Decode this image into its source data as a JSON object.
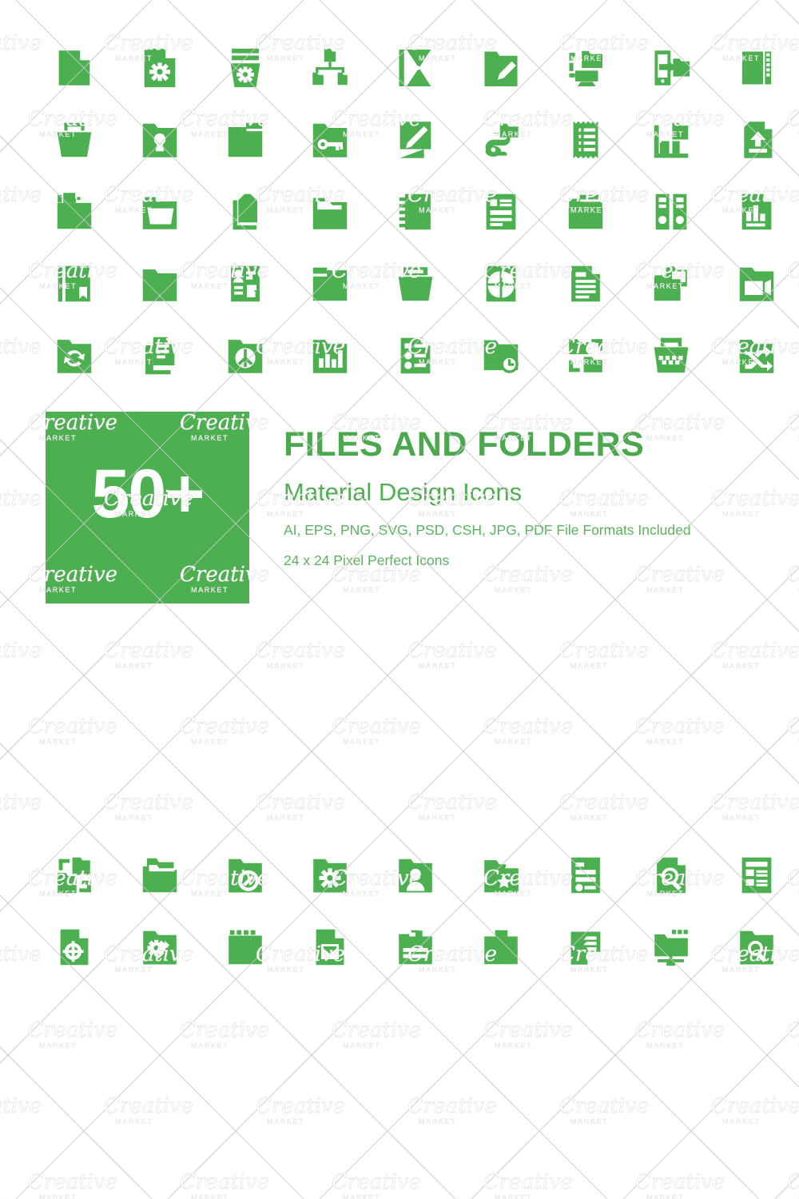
{
  "promo": {
    "badge_count": "50+",
    "badge_color": "#4caf50",
    "title": "FILES AND FOLDERS",
    "subtitle": "Material Design Icons",
    "line1": "AI, EPS, PNG, SVG, PSD, CSH, JPG, PDF File Formats Included",
    "line2": "24 x 24 Pixel Perfect Icons",
    "title_color": "#4aa84d"
  },
  "watermark": {
    "brand": "Creative",
    "sub": "MARKET"
  },
  "icon_color": "#4caf50",
  "grids": {
    "top": {
      "columns": 9,
      "rows": 5,
      "icons": [
        "file-blank-icon",
        "file-settings-icon",
        "folder-settings-icon",
        "folder-hierarchy-icon",
        "file-previous-icon",
        "folder-edit-icon",
        "folder-desktop-icon",
        "folder-mobile-transfer-icon",
        "file-zip-icon",
        "folder-basket-icon",
        "folder-lock-icon",
        "folder-blank-icon",
        "folder-key-icon",
        "file-signature-icon",
        "folder-link-icon",
        "receipt-icon",
        "folder-presentation-icon",
        "file-upload-icon",
        "folder-open-files-icon",
        "folder-open-icon",
        "file-copy-icon",
        "folder-open-empty-icon",
        "notebook-icon",
        "file-list-icon",
        "folder-archive-icon",
        "binders-icon",
        "file-chart-icon",
        "file-bookmark-icon",
        "folder-wide-icon",
        "file-profile-icon",
        "folder-tab-icon",
        "folder-drawer-icon",
        "file-pie-chart-icon",
        "file-text-icon",
        "folder-copy-icon",
        "folder-video-icon",
        "folder-sync-icon",
        "file-duplicate-list-icon",
        "folder-peace-icon",
        "folder-bar-chart-icon",
        "file-checklist-icon",
        "folder-clock-icon",
        "folder-move-icon",
        "folder-trash-icon",
        "folder-shuffle-icon"
      ]
    },
    "bottom": {
      "columns": 9,
      "rows": 2,
      "icons": [
        "folder-transfer-icon",
        "folder-layered-icon",
        "folder-blocked-icon",
        "folder-gear-icon",
        "folder-user-icon",
        "folder-star-icon",
        "file-record-icon",
        "file-search-icon",
        "file-table-icon",
        "file-target-icon",
        "folder-repair-icon",
        "folder-film-icon",
        "file-mail-icon",
        "folder-lines-icon",
        "folder-plain-icon",
        "file-fold-icon",
        "folder-network-icon",
        "folder-search-icon"
      ]
    }
  }
}
